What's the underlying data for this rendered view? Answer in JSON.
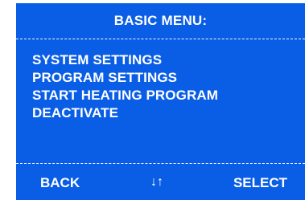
{
  "screen": {
    "title": "BASIC MENU:",
    "menu_items": [
      {
        "label": "SYSTEM SETTINGS"
      },
      {
        "label": "PROGRAM SETTINGS"
      },
      {
        "label": "START HEATING PROGRAM"
      },
      {
        "label": "DEACTIVATE"
      }
    ],
    "footer": {
      "back_label": "BACK",
      "navigate_symbol": "↓↑",
      "select_label": "SELECT"
    },
    "colors": {
      "background": "#0a5ee6",
      "text": "#ffffff"
    }
  }
}
